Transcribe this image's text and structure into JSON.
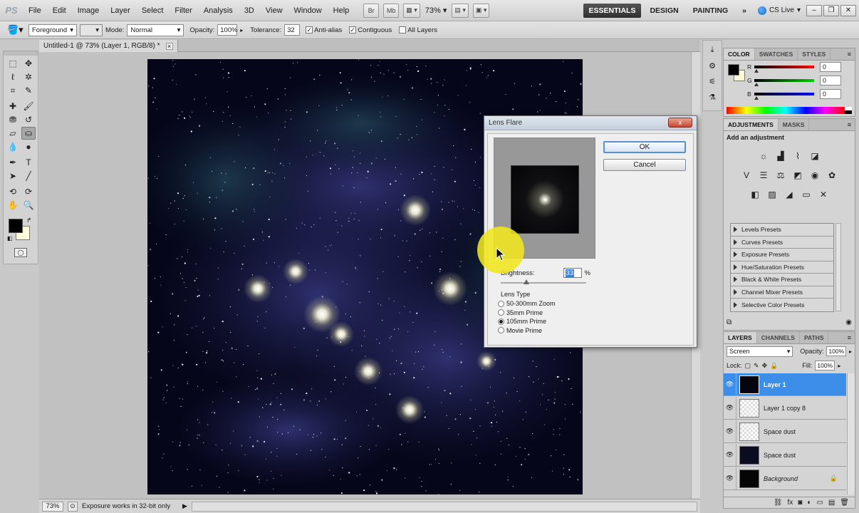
{
  "menubar": {
    "logo": "PS",
    "items": [
      "File",
      "Edit",
      "Image",
      "Layer",
      "Select",
      "Filter",
      "Analysis",
      "3D",
      "View",
      "Window",
      "Help"
    ],
    "br_label": "Br",
    "mb_label": "Mb",
    "zoom": "73%",
    "workspaces": [
      "ESSENTIALS",
      "DESIGN",
      "PAINTING"
    ],
    "more": "»",
    "cs_live": "CS Live"
  },
  "options": {
    "fill_source": "Foreground",
    "mode_label": "Mode:",
    "mode_value": "Normal",
    "opacity_label": "Opacity:",
    "opacity_value": "100%",
    "tolerance_label": "Tolerance:",
    "tolerance_value": "32",
    "antialias_label": "Anti-alias",
    "contiguous_label": "Contiguous",
    "all_layers_label": "All Layers"
  },
  "document": {
    "tab_title": "Untitled-1 @ 73% (Layer 1, RGB/8) *"
  },
  "status": {
    "zoom": "73%",
    "message": "Exposure works in 32-bit only"
  },
  "color_panel": {
    "tabs": [
      "COLOR",
      "SWATCHES",
      "STYLES"
    ],
    "r_label": "R",
    "g_label": "G",
    "b_label": "B",
    "r_value": "0",
    "g_value": "0",
    "b_value": "0",
    "fg_color": "#000000",
    "bg_color": "#fffbd8"
  },
  "adjustments": {
    "tabs": [
      "ADJUSTMENTS",
      "MASKS"
    ],
    "title": "Add an adjustment",
    "presets": [
      "Levels Presets",
      "Curves Presets",
      "Exposure Presets",
      "Hue/Saturation Presets",
      "Black & White Presets",
      "Channel Mixer Presets",
      "Selective Color Presets"
    ]
  },
  "layers_panel": {
    "tabs": [
      "LAYERS",
      "CHANNELS",
      "PATHS"
    ],
    "blend_mode": "Screen",
    "opacity_label": "Opacity:",
    "opacity_value": "100%",
    "lock_label": "Lock:",
    "fill_label": "Fill:",
    "fill_value": "100%",
    "layers": [
      {
        "name": "Layer 1",
        "selected": true
      },
      {
        "name": "Layer 1 copy 8",
        "selected": false
      },
      {
        "name": "Space dust",
        "selected": false
      },
      {
        "name": "Space dust",
        "selected": false
      },
      {
        "name": "Background",
        "selected": false
      }
    ]
  },
  "dialog": {
    "title": "Lens Flare",
    "close": "x",
    "ok": "OK",
    "cancel": "Cancel",
    "brightness_label": "Brightness:",
    "brightness_value": "33",
    "brightness_unit": "%",
    "lens_type_label": "Lens Type",
    "lens_types": [
      "50-300mm Zoom",
      "35mm Prime",
      "105mm Prime",
      "Movie Prime"
    ],
    "selected_lens": "105mm Prime"
  },
  "colors": {
    "accent": "#3d8ee8",
    "canvas_bg": "#06061a",
    "cursor_highlight": "#f0e61e"
  }
}
